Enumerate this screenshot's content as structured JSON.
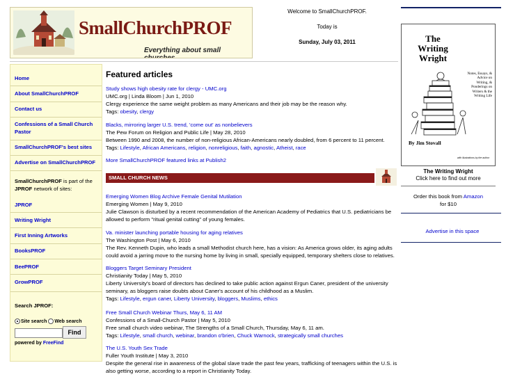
{
  "brand": {
    "name": "SmallChurchPROF",
    "tagline": "Everything about small churches"
  },
  "header": {
    "welcome": "Welcome to SmallChurchPROF.",
    "today_label": "Today is",
    "date": "Sunday, July 03, 2011"
  },
  "sidebar": {
    "nav": [
      "Home",
      "About SmallChurchPROF",
      "Contact us",
      "Confessions of a Small Church Pastor",
      "SmallChurchPROF's best sites",
      "Advertise on SmallChurchPROF"
    ],
    "network_note": {
      "b1": "SmallChurchPROF",
      "t1": " is part of the ",
      "b2": "JPROF",
      "t2": " network of sites:"
    },
    "network": [
      "JPROF",
      "Writing Wright",
      "First Inning Artworks",
      "BooksPROF",
      "BeePROF",
      "GrowPROF"
    ],
    "search_title": "Search JPROF:",
    "radio_site": "Site search",
    "radio_web": "Web search",
    "find_label": "Find",
    "powered_prefix": "powered by ",
    "powered_link": "FreeFind"
  },
  "main": {
    "heading": "Featured articles",
    "featured": [
      {
        "title": "Study shows high obesity rate for clergy - UMC.org",
        "byline": "UMC.org | Linda Bloom | Jun 1, 2010",
        "body": "Clergy experience the same weight problem as many Americans and their job may be the reason why.",
        "tags_label": "Tags: ",
        "tags": [
          "obesity",
          "clergy"
        ]
      },
      {
        "title": "Blacks, mirroring larger U.S. trend, 'come out' as nonbelievers",
        "byline": "The Pew Forum on Religion and Public Life | May 28, 2010",
        "body": "Between 1990 and 2008, the number of non-religious African-Americans nearly doubled, from 6 percent to 11 percent.",
        "tags_label": "Tags: ",
        "tags": [
          "Lifestyle",
          "African Americans",
          "religion",
          "nonreligious",
          "faith",
          "agnostic",
          "Atheist",
          "race"
        ]
      }
    ],
    "more_link": "More SmallChurchPROF featured links at Publish2",
    "news_heading": "SMALL CHURCH NEWS",
    "news": [
      {
        "title": "Emerging Women Blog Archive Female Genital Mutilation",
        "byline": "Emerging Women | May 9, 2010",
        "body": "Julie Clawson is disturbed by a recent recommendation of the American Academy of Pediatrics that U.S. pediatricians be allowed to perform \"ritual genital cutting\" of young females."
      },
      {
        "title": "Va. minister launching portable housing for aging relatives",
        "byline": "The Washington Post | May 6, 2010",
        "body": "The Rev. Kenneth Dupin, who leads a small Methodist church here, has a vision: As America grows older, its aging adults could avoid a jarring move to the nursing home by living in small, specially equipped, temporary shelters close to relatives."
      },
      {
        "title": "Bloggers Target Seminary President",
        "byline": "Christianity Today | May 5, 2010",
        "body": "Liberty University's board of directors has declined to take public action against Ergun Caner, president of the university seminary, as bloggers raise doubts about Caner's account of his childhood as a Muslim.",
        "tags_label": "Tags: ",
        "tags": [
          "Lifestyle",
          "ergun caner",
          "Liberty University",
          "bloggers",
          "Muslims",
          "ethics"
        ]
      },
      {
        "title": "Free Small Church Webinar Thurs, May 6, 11 AM",
        "byline": "Confessions of a Small-Church Pastor | May 5, 2010",
        "body": "Free small church video webinar, The Strengths of a Small Church, Thursday, May 6, 11 am.",
        "tags_label": "Tags: ",
        "tags": [
          "Lifestyle",
          "small church",
          "webinar",
          "brandon o'brien",
          "Chuck Warnock",
          "strategically small churches"
        ]
      },
      {
        "title": "The U.S. Youth Sex Trade",
        "byline": "Fuller Youth Institute | May 3, 2010",
        "body": "Despite the general rise in awareness of the global slave trade the past few years, trafficking of teenagers within the U.S. is also getting worse, according to a report in Christianity Today."
      }
    ]
  },
  "right": {
    "book_title_line1": "The",
    "book_title_line2": "Writing",
    "book_title_line3": "Wright",
    "book_subtitle": "Notes, Essays, & Advice on Writing, & Ponderings on Writers & the Writing Life",
    "book_author": "By Jim Stovall",
    "book_credit": "with illustrations by the author",
    "caption_title": "The Writing Wright",
    "caption_link": "Click here to find out more",
    "order_prefix": "Order this book from ",
    "order_store": "Amazon",
    "order_price": "for $10",
    "advertise": "Advertise in this space"
  }
}
